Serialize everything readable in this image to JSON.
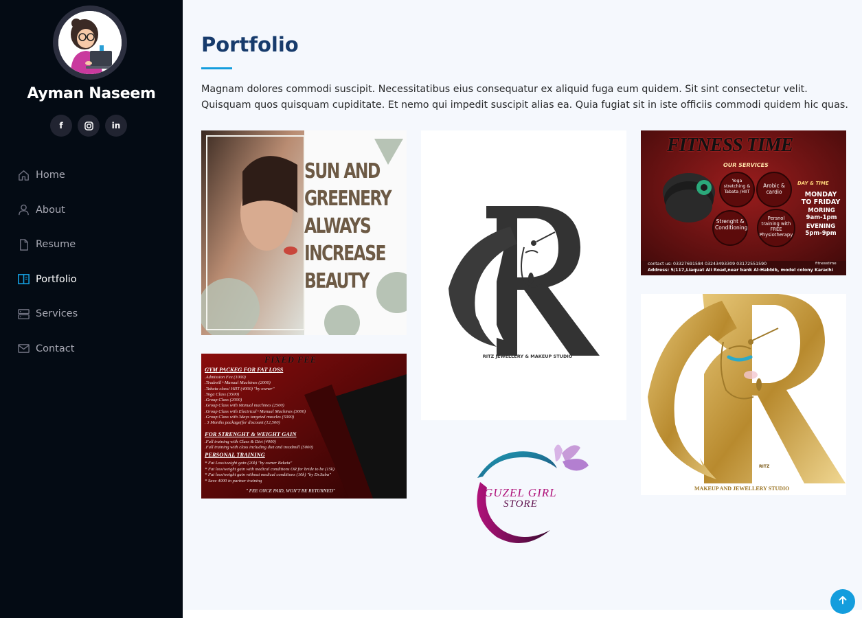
{
  "profile": {
    "name": "Ayman Naseem",
    "avatar_icon": "girl-with-laptop-avatar"
  },
  "socials": [
    {
      "icon": "facebook-icon",
      "glyph": "f"
    },
    {
      "icon": "instagram-icon",
      "glyph": "◎"
    },
    {
      "icon": "linkedin-icon",
      "glyph": "in"
    }
  ],
  "nav": {
    "items": [
      {
        "label": "Home",
        "icon": "home-icon",
        "active": false
      },
      {
        "label": "About",
        "icon": "person-icon",
        "active": false
      },
      {
        "label": "Resume",
        "icon": "file-icon",
        "active": false
      },
      {
        "label": "Portfolio",
        "icon": "book-icon",
        "active": true
      },
      {
        "label": "Services",
        "icon": "server-icon",
        "active": false
      },
      {
        "label": "Contact",
        "icon": "envelope-icon",
        "active": false
      }
    ]
  },
  "portfolio": {
    "title": "Portfolio",
    "description": "Magnam dolores commodi suscipit. Necessitatibus eius consequatur ex aliquid fuga eum quidem. Sit sint consectetur velit. Quisquam quos quisquam cupiditate. Et nemo qui impedit suscipit alias ea. Quia fugiat sit in iste officiis commodi quidem hic quas.",
    "items": {
      "sun": {
        "lines": [
          "SUN AND",
          "GREENERY",
          "ALWAYS",
          "INCREASE",
          "BEAUTY"
        ]
      },
      "ritz_dark": {
        "caption": "RITZ JEWELLERY & MAKEUP STUDIO"
      },
      "fitness": {
        "title": "FITNESS TIME",
        "subtitle": "OUR SERVICES",
        "s1": "Yoga stretching & Tabata /HIIT",
        "s2": "Arobic & cardio",
        "s3": "Strenght & Conditioning",
        "s4": "Persnol training with FREE Physiotherapy",
        "day_title": "DAY & TIME",
        "days": "MONDAY TO FRIDAY",
        "morning": "MORING 9am-1pm",
        "evening": "EVENING 5pm-9pm",
        "contact": "contact us: 03327691584 03243493309 03172551590",
        "handle": "fitnesstime",
        "address": "Address: 5/117,Liaquat Ali Road,near bank Al-Habbib, model colony Karachi"
      },
      "fixed_fee": {
        "title": "FIXED FEE",
        "h1": "GYM PACKEG FOR FAT LOSS",
        "lines1": [
          ".Admission Fee (1000)",
          ".Tradmill+Manual Machines (2000)",
          ".Tabata class/ HIIT (4000) \"by owner\"",
          ".Yoga Class (3500)",
          ".Group Class (2000)",
          ".Group Class with Manual machines (2500)",
          ".Group Class with Electrical+Manual Machines (3000)",
          ".Group Class with 3days targeted muscles (5000)",
          ". 3 Months package(for discount (12,500)"
        ],
        "h2": "FOR STRENGHT & WEIGHT GAIN",
        "lines2": [
          ".Full training with Class & Diet (4000)",
          ".Full training with class including diet and treadmill (5000)"
        ],
        "h3": "PERSONAL TRAINING",
        "lines3": [
          "* Fat Loss/weight gain (20k) \"by owner Bekeia\"",
          "* Fat loss/weight gain with medical conditions OR for bride to be (15k)",
          "* Fat loss/weight gain without medical conditions (10k) \"by Dr.Saba\"",
          "* Save 4000 in partner training"
        ],
        "footer": "\" FEE ONCE PAID, WON'T BE RETURNED\""
      },
      "guzel": {
        "line1": "GUZEL GIRL",
        "line2": "STORE"
      },
      "ritz_gold": {
        "brand": "RITZ",
        "caption": "MAKEUP AND JEWELLERY STUDIO"
      }
    }
  },
  "scroll_top_icon": "arrow-up-icon",
  "colors": {
    "sidebar_bg": "#040b14",
    "accent": "#149ddd",
    "title": "#173b6c",
    "main_bg": "#f5f8fd"
  }
}
